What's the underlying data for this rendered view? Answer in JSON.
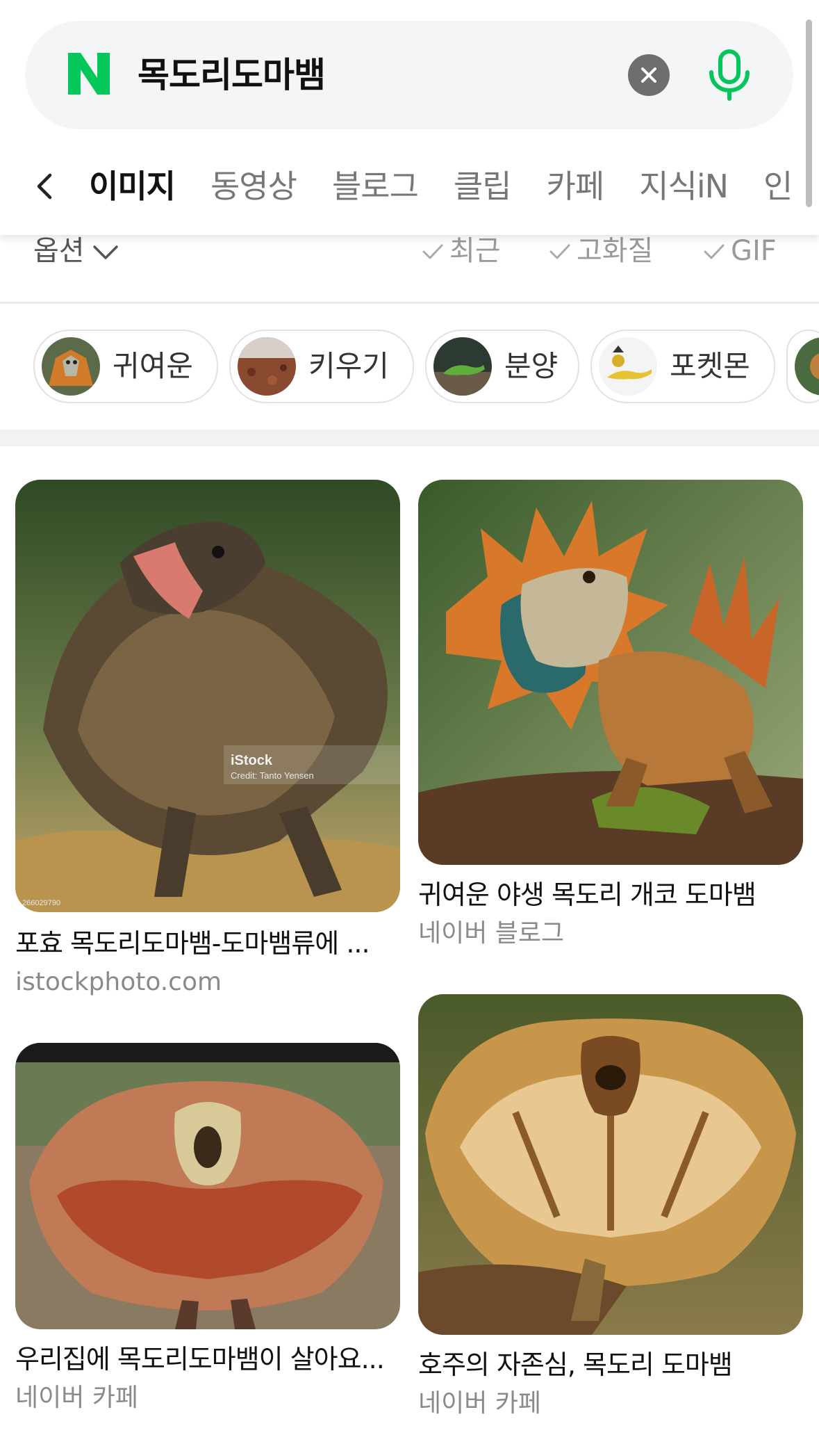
{
  "search": {
    "query": "목도리도마뱀"
  },
  "tabs": [
    "이미지",
    "동영상",
    "블로그",
    "클립",
    "카페",
    "지식iN",
    "인"
  ],
  "options": {
    "label": "옵션",
    "filters": [
      "최근",
      "고화질",
      "GIF"
    ]
  },
  "chips": [
    {
      "label": "귀여운",
      "icon": "frilled-lizard-thumb"
    },
    {
      "label": "키우기",
      "icon": "terrarium-thumb"
    },
    {
      "label": "분양",
      "icon": "green-lizard-thumb"
    },
    {
      "label": "포켓몬",
      "icon": "pokemon-thumb"
    }
  ],
  "results": [
    {
      "title": "포효 목도리도마뱀-도마뱀류에 ...",
      "source": "istockphoto.com",
      "watermark": {
        "brand": "iStock",
        "credit": "Credit: Tanto Yensen",
        "id": "266029790"
      }
    },
    {
      "title": "귀여운 야생 목도리 개코 도마뱀",
      "source": "네이버 블로그"
    },
    {
      "title": "우리집에 목도리도마뱀이 살아요...",
      "source": "네이버 카페"
    },
    {
      "title": "호주의 자존심, 목도리 도마뱀",
      "source": "네이버 카페"
    }
  ],
  "colors": {
    "naver_green": "#03c75a",
    "mic_green": "#03c75a",
    "text_dark": "#111111",
    "text_gray": "#8a8a8a"
  }
}
